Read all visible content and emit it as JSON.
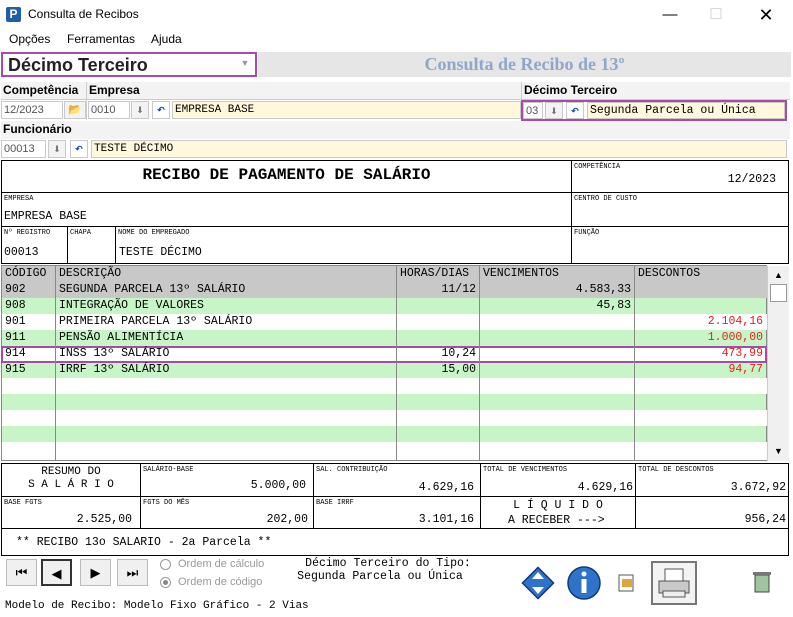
{
  "window": {
    "title": "Consulta de Recibos",
    "icon": "P"
  },
  "menu": [
    "Opções",
    "Ferramentas",
    "Ajuda"
  ],
  "type_combo": {
    "value": "Décimo Terceiro"
  },
  "page_heading": "Consulta de Recibo de 13º",
  "labels": {
    "competencia": "Competência",
    "empresa": "Empresa",
    "decimo": "Décimo Terceiro",
    "funcionario": "Funcionário"
  },
  "fields": {
    "competencia": "12/2023",
    "empresa_code": "0010",
    "empresa_name": "EMPRESA BASE",
    "decimo_code": "03",
    "decimo_name": "Segunda Parcela ou Única",
    "funcionario_code": "00013",
    "funcionario_name": "TESTE DÉCIMO"
  },
  "receipt": {
    "title": "RECIBO DE PAGAMENTO DE SALÁRIO",
    "competencia_label": "COMPETÊNCIA",
    "competencia": "12/2023",
    "empresa_label": "EMPRESA",
    "empresa": "EMPRESA BASE",
    "centro_label": "CENTRO DE CUSTO",
    "registro_label": "Nº REGISTRO",
    "registro": "00013",
    "chapa_label": "CHAPA",
    "nome_label": "NOME DO EMPREGADO",
    "nome": "TESTE DÉCIMO",
    "funcao_label": "FUNÇÃO"
  },
  "table": {
    "headers": [
      "CÓDIGO",
      "DESCRIÇÃO",
      "HORAS/DIAS",
      "VENCIMENTOS",
      "DESCONTOS"
    ],
    "rows": [
      {
        "codigo": "902",
        "descricao": "SEGUNDA PARCELA 13º SALÁRIO",
        "horas": "11/12",
        "venc": "4.583,33",
        "desc": ""
      },
      {
        "codigo": "908",
        "descricao": "INTEGRAÇÃO DE VALORES",
        "horas": "",
        "venc": "45,83",
        "desc": ""
      },
      {
        "codigo": "901",
        "descricao": "PRIMEIRA PARCELA 13º SALÁRIO",
        "horas": "",
        "venc": "",
        "desc": "2.104,16"
      },
      {
        "codigo": "911",
        "descricao": "PENSÃO ALIMENTÍCIA",
        "horas": "",
        "venc": "",
        "desc": "1.000,00"
      },
      {
        "codigo": "914",
        "descricao": "INSS 13º SALÁRIO",
        "horas": "10,24",
        "venc": "",
        "desc": "473,99"
      },
      {
        "codigo": "915",
        "descricao": "IRRF 13º SALÁRIO",
        "horas": "15,00",
        "venc": "",
        "desc": "94,77"
      }
    ]
  },
  "summary": {
    "resumo_line1": "RESUMO DO",
    "resumo_line2": "S A L Á R I O",
    "salario_base_label": "SALÁRIO-BASE",
    "salario_base": "5.000,00",
    "sal_contrib_label": "SAL. CONTRIBUIÇÃO",
    "sal_contrib": "4.629,16",
    "total_venc_label": "TOTAL DE VENCIMENTOS",
    "total_venc": "4.629,16",
    "total_desc_label": "TOTAL DE DESCONTOS",
    "total_desc": "3.672,92",
    "base_fgts_label": "BASE FGTS",
    "base_fgts": "2.525,00",
    "fgts_mes_label": "FGTS DO MÊS",
    "fgts_mes": "202,00",
    "base_irrf_label": "BASE IRRF",
    "base_irrf": "3.101,16",
    "liquido_line1": "L Í Q U I D O",
    "liquido_line2": "A RECEBER --->",
    "liquido": "956,24"
  },
  "note": "** RECIBO 13o SALARIO - 2a Parcela **",
  "radio": {
    "calc": "Ordem de cálculo",
    "code": "Ordem de código"
  },
  "type_info": {
    "line1": "Décimo Terceiro do Tipo:",
    "line2": "Segunda Parcela ou Única"
  },
  "status": "Modelo de Recibo: Modelo Fixo Gráfico - 2 Vias",
  "colors": {
    "green_row": "#c8f5c8",
    "gray_row": "#c8c8c8",
    "highlight": "#a64ca6",
    "negative": "#e8201a"
  }
}
